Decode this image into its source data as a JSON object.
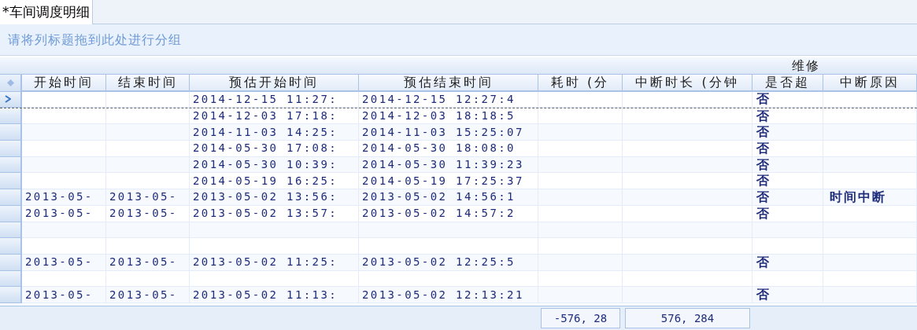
{
  "tabs": [
    {
      "label": "*车间调度明细",
      "selected": true
    }
  ],
  "group_panel": {
    "hint": "请将列标题拖到此处进行分组"
  },
  "band": {
    "label": "维修"
  },
  "columns": [
    "开始时间",
    "结束时间",
    "预估开始时间",
    "预估结束时间",
    "耗时 (分",
    "中断时长 (分钟",
    "是否超",
    "中断原因"
  ],
  "rows": [
    {
      "selected": true,
      "cells": [
        "",
        "",
        "2014-12-15 11:27:",
        "2014-12-15 12:27:4",
        "",
        "",
        "否",
        ""
      ]
    },
    {
      "selected": false,
      "cells": [
        "",
        "",
        "2014-12-03 17:18:",
        "2014-12-03 18:18:5",
        "",
        "",
        "否",
        ""
      ]
    },
    {
      "selected": false,
      "cells": [
        "",
        "",
        "2014-11-03 14:25:",
        "2014-11-03 15:25:07",
        "",
        "",
        "否",
        ""
      ]
    },
    {
      "selected": false,
      "cells": [
        "",
        "",
        "2014-05-30 17:08:",
        "2014-05-30 18:08:0",
        "",
        "",
        "否",
        ""
      ]
    },
    {
      "selected": false,
      "cells": [
        "",
        "",
        "2014-05-30 10:39:",
        "2014-05-30 11:39:23",
        "",
        "",
        "否",
        ""
      ]
    },
    {
      "selected": false,
      "cells": [
        "",
        "",
        "2014-05-19 16:25:",
        "2014-05-19 17:25:37",
        "",
        "",
        "否",
        ""
      ]
    },
    {
      "selected": false,
      "cells": [
        "2013-05-",
        "2013-05-",
        "2013-05-02 13:56:",
        "2013-05-02 14:56:1",
        "",
        "",
        "否",
        "时间中断"
      ]
    },
    {
      "selected": false,
      "cells": [
        "2013-05-",
        "2013-05-",
        "2013-05-02 13:57:",
        "2013-05-02 14:57:2",
        "",
        "",
        "否",
        ""
      ]
    },
    {
      "selected": false,
      "cells": [
        "",
        "",
        "",
        "",
        "",
        "",
        "",
        ""
      ]
    },
    {
      "selected": false,
      "cells": [
        "",
        "",
        "",
        "",
        "",
        "",
        "",
        ""
      ]
    },
    {
      "selected": false,
      "cells": [
        "2013-05-",
        "2013-05-",
        "2013-05-02 11:25:",
        "2013-05-02 12:25:5",
        "",
        "",
        "否",
        ""
      ]
    },
    {
      "selected": false,
      "cells": [
        "",
        "",
        "",
        "",
        "",
        "",
        "",
        ""
      ]
    },
    {
      "selected": false,
      "cells": [
        "2013-05-",
        "2013-05-",
        "2013-05-02 11:13:",
        "2013-05-02 12:13:21",
        "",
        "",
        "否",
        ""
      ]
    }
  ],
  "summary": {
    "duration": "-576, 28",
    "interruption": "576, 284"
  }
}
